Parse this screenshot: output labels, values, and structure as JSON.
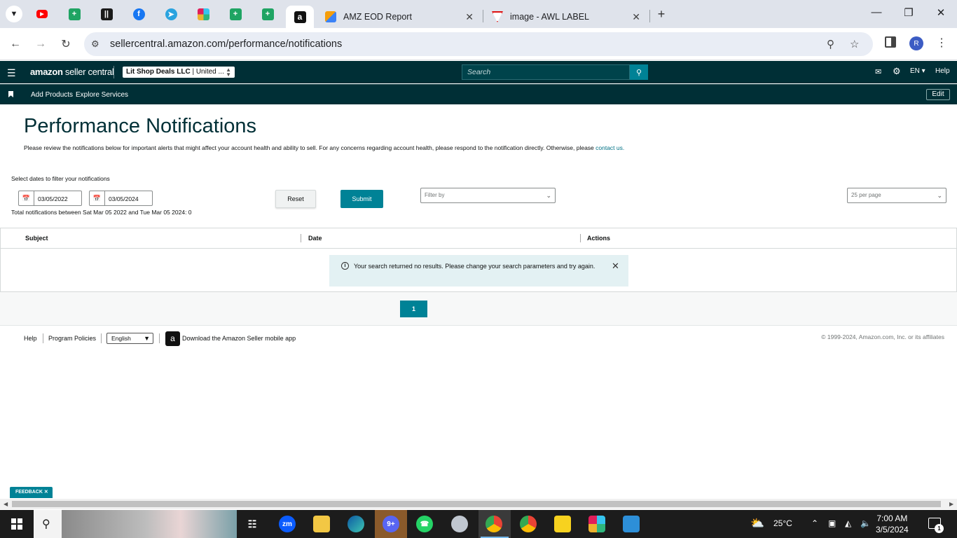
{
  "browser": {
    "tabs": [
      {
        "title": "AMZ EOD Report"
      },
      {
        "title": "image - AWL LABEL"
      }
    ],
    "url": "sellercentral.amazon.com/performance/notifications",
    "profile_initial": "R"
  },
  "header": {
    "logo_bold": "amazon",
    "logo_rest": " seller central",
    "account_name": "Lit Shop Deals LLC",
    "account_region": " | United ...",
    "search_placeholder": "Search",
    "language": "EN",
    "help": "Help"
  },
  "subnav": {
    "items": [
      "Add Products",
      "Explore Services"
    ],
    "edit": "Edit"
  },
  "page": {
    "title": "Performance Notifications",
    "description": "Please review the notifications below for important alerts that might affect your account health and ability to sell. For any concerns regarding account health, please respond to the notification directly. Otherwise, please ",
    "contact_link": "contact us.",
    "filter_label": "Select dates to filter your notifications",
    "date_from": "03/05/2022",
    "date_to": "03/05/2024",
    "reset": "Reset",
    "submit": "Submit",
    "filter_placeholder": "Filter by",
    "per_page": "25 per page",
    "total_line": "Total notifications between Sat Mar 05 2022 and Tue Mar 05 2024: 0"
  },
  "table": {
    "columns": [
      "Subject",
      "Date",
      "Actions"
    ],
    "empty_message": "Your search returned no results. Please change your search parameters and try again."
  },
  "pagination": {
    "current": "1"
  },
  "footer": {
    "help": "Help",
    "policies": "Program Policies",
    "language": "English",
    "app_text": "Download the Amazon Seller mobile app",
    "copyright": "© 1999-2024, Amazon.com, Inc. or its affiliates"
  },
  "feedback": "FEEDBACK",
  "taskbar": {
    "weather": "25°C",
    "time": "7:00 AM",
    "date": "3/5/2024",
    "notification_count": "1"
  }
}
